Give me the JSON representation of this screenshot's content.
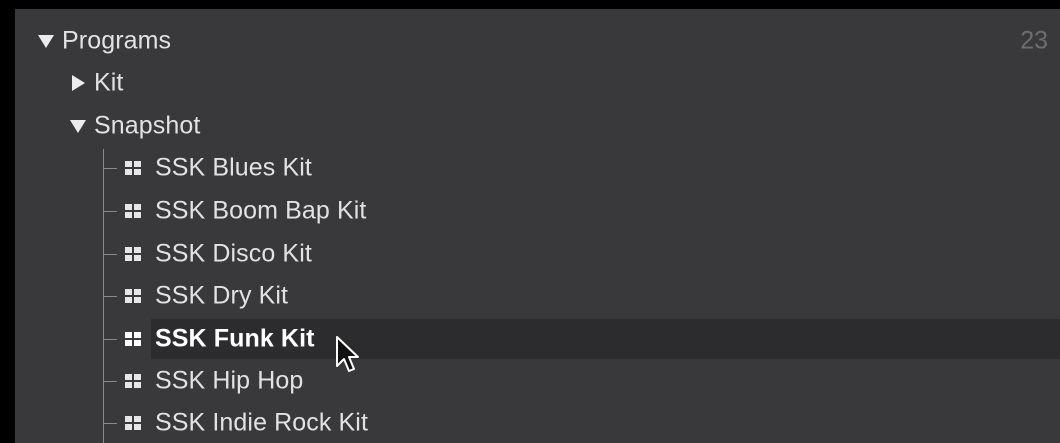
{
  "tree": {
    "root": {
      "label": "Programs",
      "count": "23",
      "expanded": true
    },
    "folders": [
      {
        "label": "Kit",
        "expanded": false
      },
      {
        "label": "Snapshot",
        "expanded": true
      }
    ],
    "snapshot_items": [
      {
        "label": "SSK Blues Kit",
        "selected": false
      },
      {
        "label": "SSK Boom Bap Kit",
        "selected": false
      },
      {
        "label": "SSK Disco Kit",
        "selected": false
      },
      {
        "label": "SSK Dry Kit",
        "selected": false
      },
      {
        "label": "SSK Funk Kit",
        "selected": true
      },
      {
        "label": "SSK Hip Hop",
        "selected": false
      },
      {
        "label": "SSK Indie Rock Kit",
        "selected": false
      }
    ]
  },
  "icons": {
    "expanded": "triangle-down-icon",
    "collapsed": "triangle-right-icon",
    "program": "grid-icon",
    "cursor": "mouse-pointer-icon"
  },
  "colors": {
    "panel": "#39393b",
    "text": "#e2e2e2",
    "selected_text": "#ffffff",
    "selected_row": "#2c2c2e",
    "count": "#6e6e70"
  }
}
